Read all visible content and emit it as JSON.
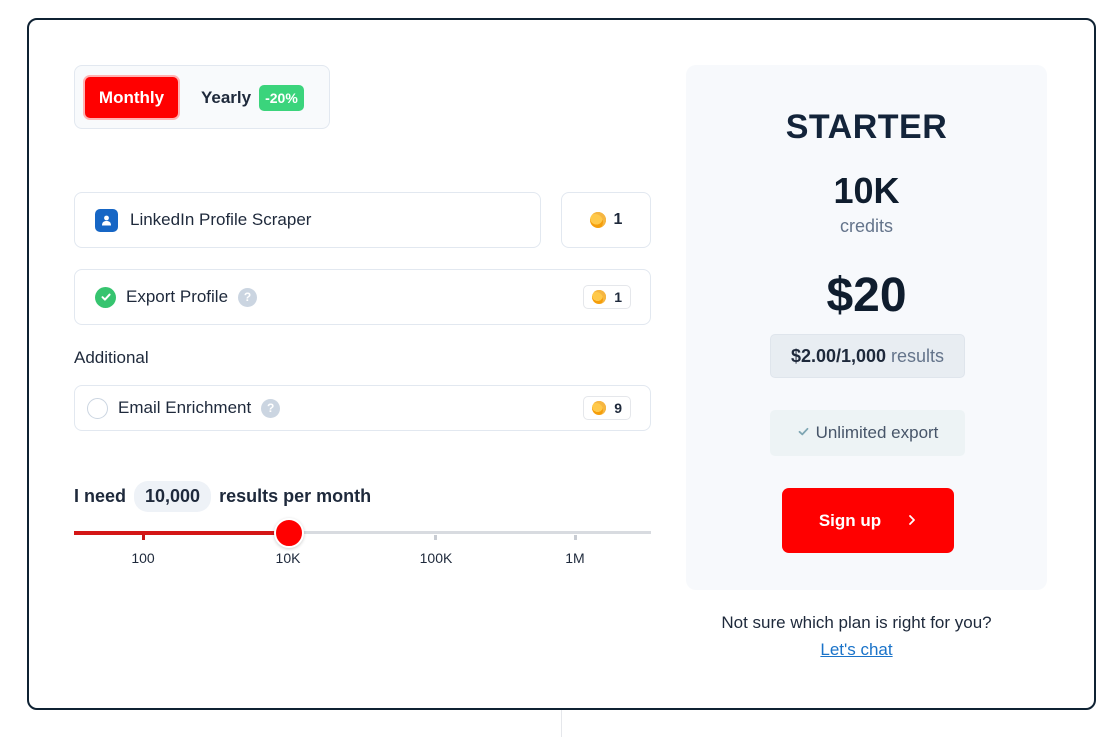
{
  "billing_toggle": {
    "monthly_label": "Monthly",
    "yearly_label": "Yearly",
    "yearly_discount": "-20%"
  },
  "features": {
    "scraper": {
      "label": "LinkedIn Profile Scraper",
      "credits": "1",
      "icon": "person-icon"
    },
    "export": {
      "label": "Export Profile",
      "credits": "1",
      "checked": true
    },
    "additional_heading": "Additional",
    "email": {
      "label": "Email Enrichment",
      "credits": "9",
      "checked": false
    }
  },
  "results": {
    "prefix": "I need",
    "quantity": "10,000",
    "suffix": "results per month",
    "slider": {
      "ticks": [
        "100",
        "10K",
        "100K",
        "1M"
      ],
      "selected_index": 1,
      "fill_fraction": 0.372
    }
  },
  "plan": {
    "name": "STARTER",
    "credits_amount": "10K",
    "credits_word": "credits",
    "price": "$20",
    "rate": "$2.00/1,000",
    "rate_word": "results",
    "feature": "Unlimited export",
    "cta": "Sign up"
  },
  "help": {
    "question": "Not sure which plan is right for you?",
    "link": "Let's chat"
  },
  "colors": {
    "accent": "#ff0000",
    "discount": "#3bd47c",
    "check": "#36c46f",
    "link": "#1a73c9"
  }
}
